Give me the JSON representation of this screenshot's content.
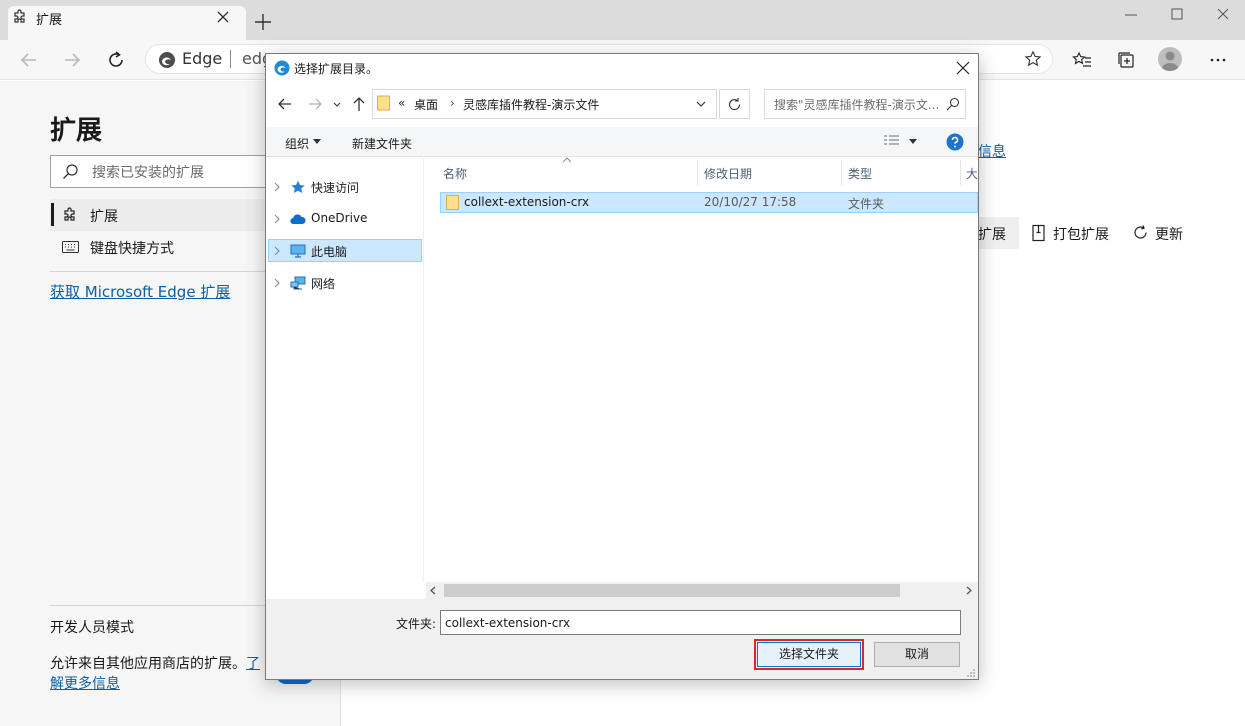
{
  "browser": {
    "tab_title": "扩展",
    "address_brand": "Edge",
    "address_url": "edg"
  },
  "page": {
    "title": "扩展",
    "search_placeholder": "搜索已安装的扩展",
    "nav": [
      "扩展",
      "键盘快捷方式"
    ],
    "store_link": "获取 Microsoft Edge 扩展",
    "dev_mode": "开发人员模式",
    "allow_text": "允许来自其他应用商店的扩展。",
    "allow_link_part1": "了",
    "allow_link_part2": "解更多信息",
    "info_link": "信息",
    "actions": {
      "load": "扩展",
      "pack": "打包扩展",
      "update": "更新"
    }
  },
  "dialog": {
    "title": "选择扩展目录。",
    "breadcrumb": {
      "overflow": "«",
      "items": [
        "桌面",
        "灵感库插件教程-演示文件"
      ]
    },
    "search_placeholder": "搜索\"灵感库插件教程-演示文...",
    "commands": {
      "organize": "组织",
      "new_folder": "新建文件夹"
    },
    "nav_items": [
      "快速访问",
      "OneDrive",
      "此电脑",
      "网络"
    ],
    "columns": [
      "名称",
      "修改日期",
      "类型",
      "大"
    ],
    "files": [
      {
        "name": "collext-extension-crx",
        "modified": "20/10/27 17:58",
        "type": "文件夹"
      }
    ],
    "folder_label": "文件夹:",
    "folder_value": "collext-extension-crx",
    "select_button": "选择文件夹",
    "cancel_button": "取消"
  },
  "colors": {
    "accent": "#0078d7",
    "selection": "#cce8ff",
    "link": "#0b5fa5",
    "highlight_outline": "#e0242b"
  }
}
